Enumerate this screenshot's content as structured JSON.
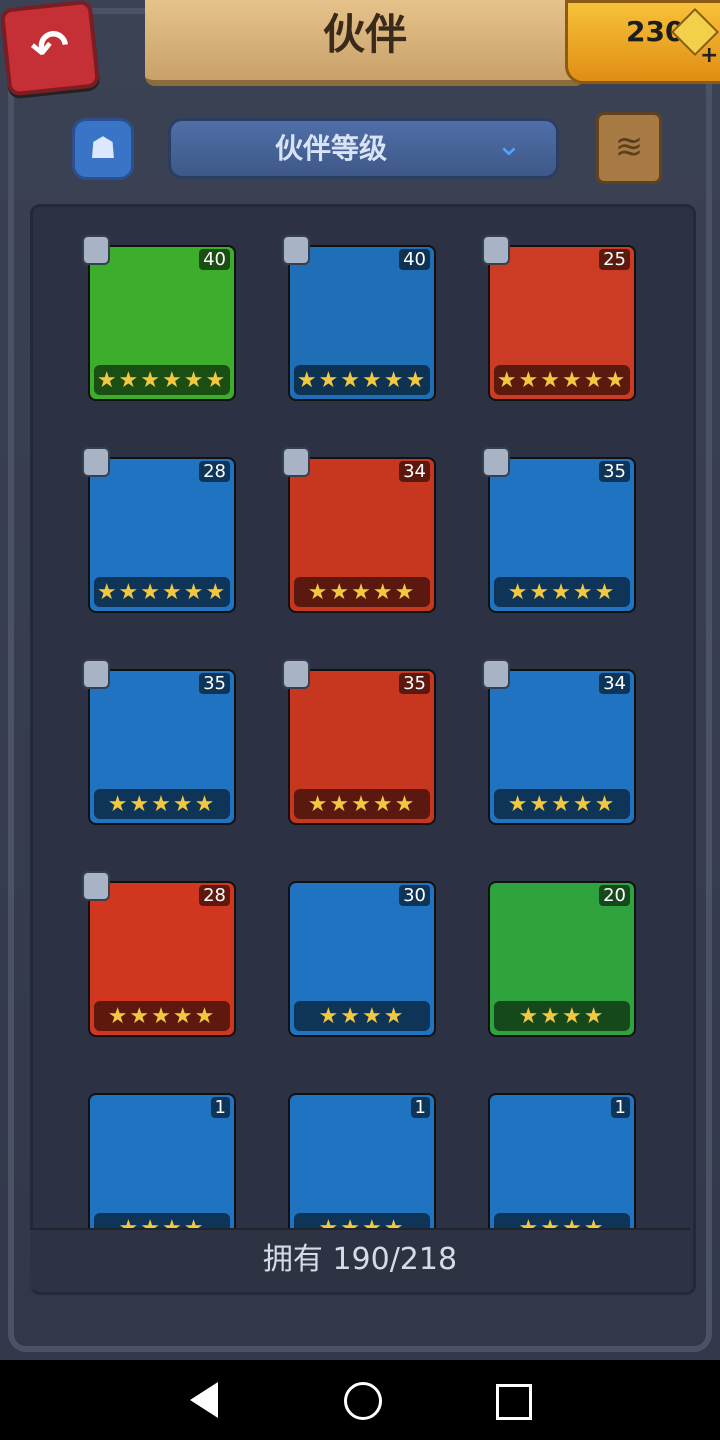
{
  "header": {
    "title": "伙伴",
    "back_label": "↶"
  },
  "currency": {
    "amount": "230"
  },
  "filter": {
    "label": "伙伴等级"
  },
  "cards": [
    {
      "level": "40",
      "stars": "★★★★★★",
      "bg": "#3cae2b"
    },
    {
      "level": "40",
      "stars": "★★★★★★",
      "bg": "#1f6fb7"
    },
    {
      "level": "25",
      "stars": "★★★★★★",
      "bg": "#cc3b23"
    },
    {
      "level": "28",
      "stars": "★★★★★★",
      "bg": "#1f73c0"
    },
    {
      "level": "34",
      "stars": "★★★★★",
      "bg": "#c7361f"
    },
    {
      "level": "35",
      "stars": "★★★★★",
      "bg": "#1f73c0"
    },
    {
      "level": "35",
      "stars": "★★★★★",
      "bg": "#1f73c0"
    },
    {
      "level": "35",
      "stars": "★★★★★",
      "bg": "#c7361f"
    },
    {
      "level": "34",
      "stars": "★★★★★",
      "bg": "#1f73c0"
    },
    {
      "level": "28",
      "stars": "★★★★★",
      "bg": "#d1371f"
    },
    {
      "level": "30",
      "stars": "★★★★",
      "bg": "#1f73c0"
    },
    {
      "level": "20",
      "stars": "★★★★",
      "bg": "#2fa33d"
    },
    {
      "level": "1",
      "stars": "★★★★",
      "bg": "#1f73c0"
    },
    {
      "level": "1",
      "stars": "★★★★",
      "bg": "#1f73c0"
    },
    {
      "level": "1",
      "stars": "★★★★",
      "bg": "#1f73c0"
    }
  ],
  "footer": {
    "owned_text": "拥有 190/218"
  }
}
